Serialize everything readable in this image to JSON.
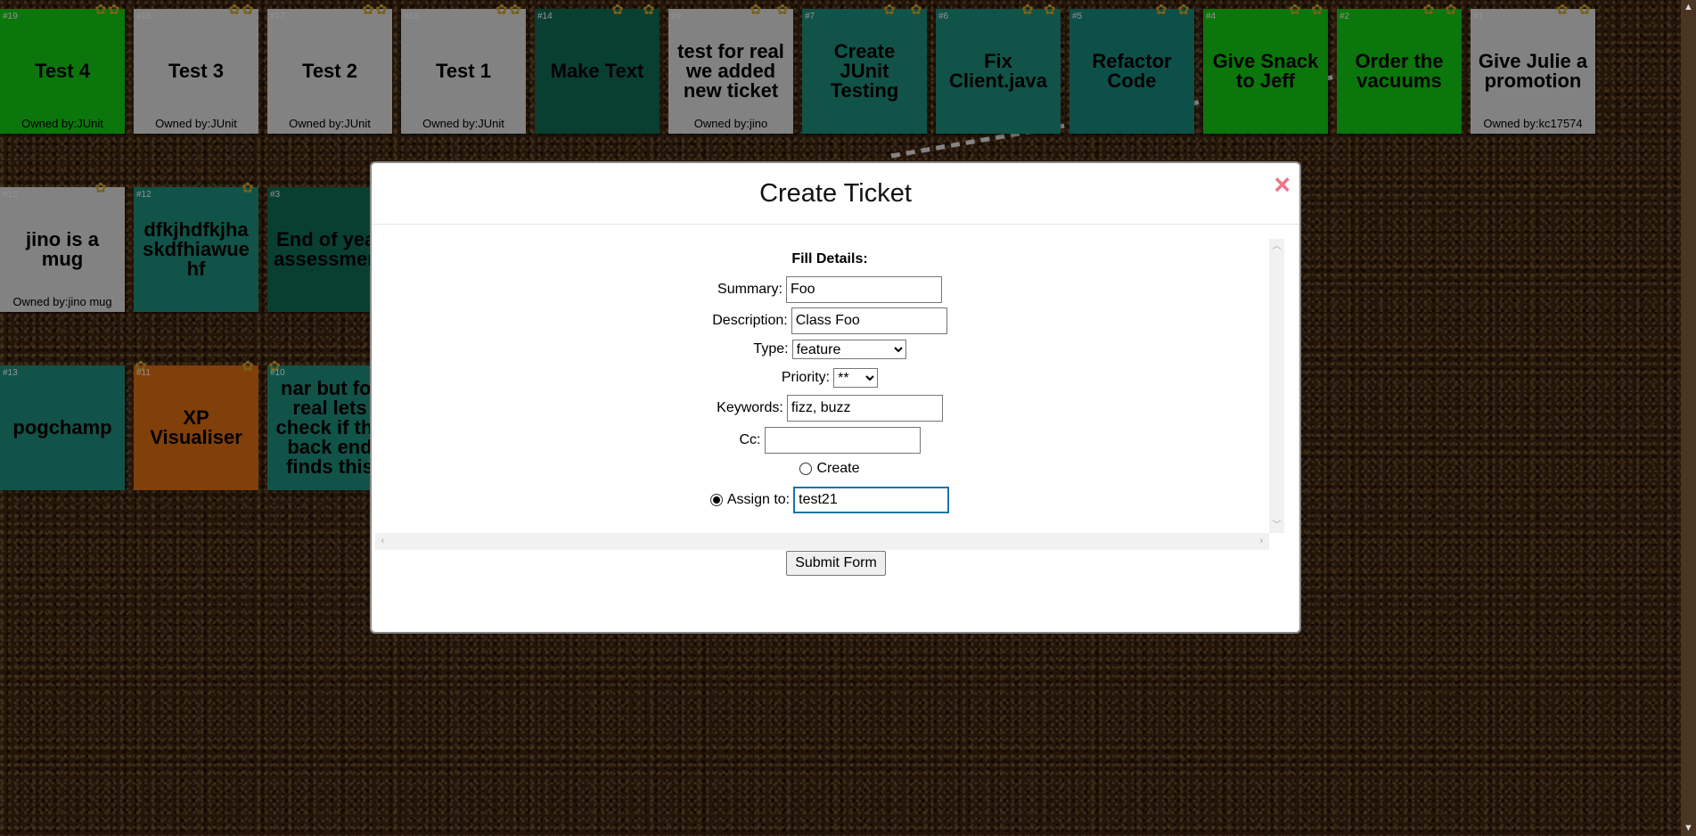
{
  "notes": [
    {
      "id": "#19",
      "title": "Test 4",
      "owner": "Owned by:JUnit"
    },
    {
      "id": "#18",
      "title": "Test 3",
      "owner": "Owned by:JUnit"
    },
    {
      "id": "#17",
      "title": "Test 2",
      "owner": "Owned by:JUnit"
    },
    {
      "id": "#16",
      "title": "Test 1",
      "owner": "Owned by:JUnit"
    },
    {
      "id": "#14",
      "title": "Make Text",
      "owner": ""
    },
    {
      "id": "#9",
      "title": "test for real we added new ticket",
      "owner": "Owned by:jino"
    },
    {
      "id": "#7",
      "title": "Create JUnit Testing",
      "owner": ""
    },
    {
      "id": "#6",
      "title": "Fix Client.java",
      "owner": ""
    },
    {
      "id": "#5",
      "title": "Refactor Code",
      "owner": ""
    },
    {
      "id": "#4",
      "title": "Give Snack to Jeff",
      "owner": ""
    },
    {
      "id": "#2",
      "title": "Order the vacuums",
      "owner": ""
    },
    {
      "id": "#1",
      "title": "Give Julie a promotion",
      "owner": "Owned by:kc17574"
    },
    {
      "id": "#15",
      "title": "jino is a mug",
      "owner": "Owned by:jino mug"
    },
    {
      "id": "#12",
      "title": "dfkjhdfkjha skdfhiawue hf",
      "owner": ""
    },
    {
      "id": "#3",
      "title": "End of year assessment",
      "owner": ""
    },
    {
      "id": "#13",
      "title": "pogchamp",
      "owner": ""
    },
    {
      "id": "#11",
      "title": "XP Visualiser",
      "owner": ""
    },
    {
      "id": "#10",
      "title": "nar but for real lets check if the back end finds this",
      "owner": ""
    }
  ],
  "modal": {
    "title": "Create Ticket",
    "close_icon": "×",
    "fill_heading": "Fill Details:",
    "summary": {
      "label": "Summary:",
      "value": "Foo"
    },
    "description": {
      "label": "Description:",
      "value": "Class Foo"
    },
    "type": {
      "label": "Type:",
      "selected": "feature"
    },
    "priority": {
      "label": "Priority:",
      "selected": "**"
    },
    "keywords": {
      "label": "Keywords:",
      "value": "fizz, buzz"
    },
    "cc": {
      "label": "Cc:",
      "value": ""
    },
    "create_option": {
      "label": "Create",
      "checked": false
    },
    "assign_option": {
      "label": "Assign to:",
      "checked": true,
      "value": "test21"
    },
    "submit_label": "Submit Form"
  },
  "colors": {
    "green": "#13c513",
    "gray": "#d9d9d9",
    "dark_teal": "#0f6a52",
    "teal": "#1d8a78",
    "orange": "#d86a10",
    "close_pink": "#f0758a"
  },
  "icons": {
    "pin": "pin-icon",
    "close": "close-icon",
    "scroll_up": "scroll-up-arrow-icon",
    "scroll_down": "scroll-down-arrow-icon"
  }
}
